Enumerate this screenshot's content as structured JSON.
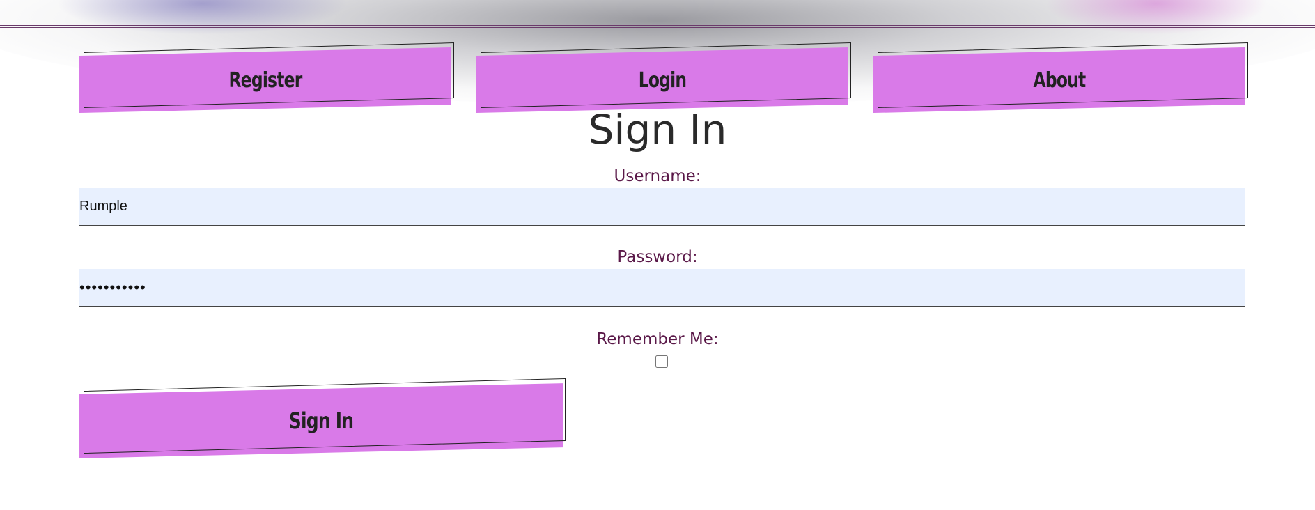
{
  "nav": {
    "register_label": "Register",
    "login_label": "Login",
    "about_label": "About"
  },
  "form": {
    "title": "Sign In",
    "username_label": "Username:",
    "username_value": "Rumple",
    "password_label": "Password:",
    "password_value": "•••••••••••",
    "remember_label": "Remember Me:",
    "remember_checked": false,
    "submit_label": "Sign In"
  },
  "colors": {
    "button_fill": "#d97ae8",
    "label_text": "#5a1848",
    "input_background": "#e8f0fe",
    "title_text": "#2a2a2a"
  }
}
